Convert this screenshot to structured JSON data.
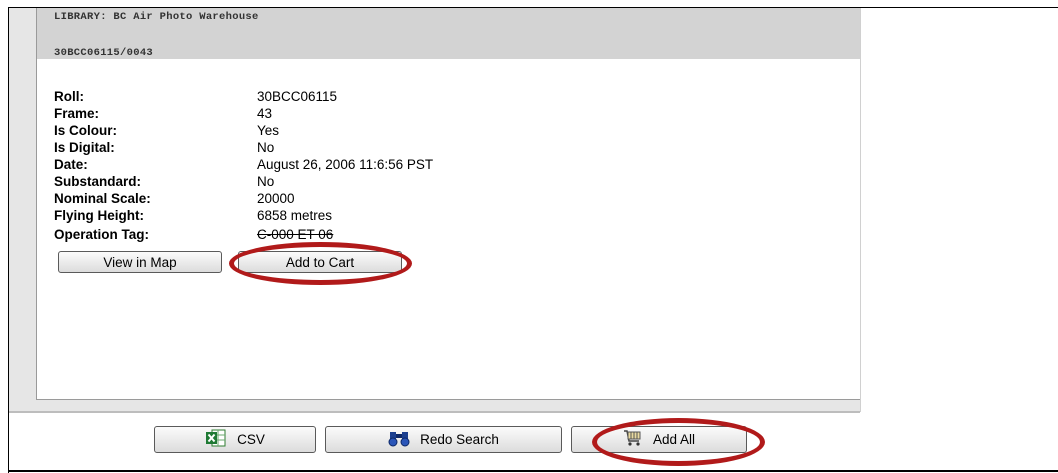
{
  "header": {
    "library_line": "LIBRARY: BC Air Photo Warehouse",
    "record_id": "30BCC06115/0043"
  },
  "fields": [
    {
      "label": "Roll:",
      "value": "30BCC06115"
    },
    {
      "label": "Frame:",
      "value": "43"
    },
    {
      "label": "Is Colour:",
      "value": "Yes"
    },
    {
      "label": "Is Digital:",
      "value": "No"
    },
    {
      "label": "Date:",
      "value": "August 26, 2006 11:6:56 PST"
    },
    {
      "label": "Substandard:",
      "value": "No"
    },
    {
      "label": "Nominal Scale:",
      "value": "20000"
    },
    {
      "label": "Flying Height:",
      "value": "6858 metres"
    },
    {
      "label": "Operation Tag:",
      "value": "C-000 ET 06"
    }
  ],
  "record_buttons": {
    "view_in_map": "View in Map",
    "add_to_cart": "Add to Cart"
  },
  "footer_buttons": {
    "csv": "CSV",
    "redo_search": "Redo Search",
    "add_all": "Add All"
  },
  "icons": {
    "csv": "excel-icon",
    "redo_search": "binoculars-icon",
    "add_all": "cart-icon"
  },
  "colors": {
    "highlight_ring": "#b11a1a",
    "header_band": "#d3d3d3"
  }
}
